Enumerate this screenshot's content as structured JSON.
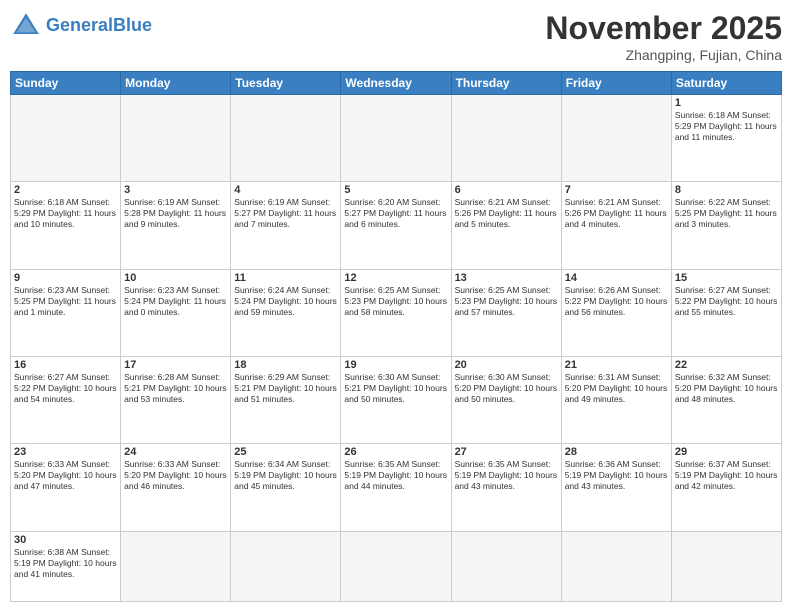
{
  "header": {
    "logo_general": "General",
    "logo_blue": "Blue",
    "month": "November 2025",
    "location": "Zhangping, Fujian, China"
  },
  "days_of_week": [
    "Sunday",
    "Monday",
    "Tuesday",
    "Wednesday",
    "Thursday",
    "Friday",
    "Saturday"
  ],
  "weeks": [
    [
      {
        "day": "",
        "info": "",
        "empty": true
      },
      {
        "day": "",
        "info": "",
        "empty": true
      },
      {
        "day": "",
        "info": "",
        "empty": true
      },
      {
        "day": "",
        "info": "",
        "empty": true
      },
      {
        "day": "",
        "info": "",
        "empty": true
      },
      {
        "day": "",
        "info": "",
        "empty": true
      },
      {
        "day": "1",
        "info": "Sunrise: 6:18 AM\nSunset: 5:29 PM\nDaylight: 11 hours\nand 11 minutes.",
        "empty": false
      }
    ],
    [
      {
        "day": "2",
        "info": "Sunrise: 6:18 AM\nSunset: 5:29 PM\nDaylight: 11 hours\nand 10 minutes.",
        "empty": false
      },
      {
        "day": "3",
        "info": "Sunrise: 6:19 AM\nSunset: 5:28 PM\nDaylight: 11 hours\nand 9 minutes.",
        "empty": false
      },
      {
        "day": "4",
        "info": "Sunrise: 6:19 AM\nSunset: 5:27 PM\nDaylight: 11 hours\nand 7 minutes.",
        "empty": false
      },
      {
        "day": "5",
        "info": "Sunrise: 6:20 AM\nSunset: 5:27 PM\nDaylight: 11 hours\nand 6 minutes.",
        "empty": false
      },
      {
        "day": "6",
        "info": "Sunrise: 6:21 AM\nSunset: 5:26 PM\nDaylight: 11 hours\nand 5 minutes.",
        "empty": false
      },
      {
        "day": "7",
        "info": "Sunrise: 6:21 AM\nSunset: 5:26 PM\nDaylight: 11 hours\nand 4 minutes.",
        "empty": false
      },
      {
        "day": "8",
        "info": "Sunrise: 6:22 AM\nSunset: 5:25 PM\nDaylight: 11 hours\nand 3 minutes.",
        "empty": false
      }
    ],
    [
      {
        "day": "9",
        "info": "Sunrise: 6:23 AM\nSunset: 5:25 PM\nDaylight: 11 hours\nand 1 minute.",
        "empty": false
      },
      {
        "day": "10",
        "info": "Sunrise: 6:23 AM\nSunset: 5:24 PM\nDaylight: 11 hours\nand 0 minutes.",
        "empty": false
      },
      {
        "day": "11",
        "info": "Sunrise: 6:24 AM\nSunset: 5:24 PM\nDaylight: 10 hours\nand 59 minutes.",
        "empty": false
      },
      {
        "day": "12",
        "info": "Sunrise: 6:25 AM\nSunset: 5:23 PM\nDaylight: 10 hours\nand 58 minutes.",
        "empty": false
      },
      {
        "day": "13",
        "info": "Sunrise: 6:25 AM\nSunset: 5:23 PM\nDaylight: 10 hours\nand 57 minutes.",
        "empty": false
      },
      {
        "day": "14",
        "info": "Sunrise: 6:26 AM\nSunset: 5:22 PM\nDaylight: 10 hours\nand 56 minutes.",
        "empty": false
      },
      {
        "day": "15",
        "info": "Sunrise: 6:27 AM\nSunset: 5:22 PM\nDaylight: 10 hours\nand 55 minutes.",
        "empty": false
      }
    ],
    [
      {
        "day": "16",
        "info": "Sunrise: 6:27 AM\nSunset: 5:22 PM\nDaylight: 10 hours\nand 54 minutes.",
        "empty": false
      },
      {
        "day": "17",
        "info": "Sunrise: 6:28 AM\nSunset: 5:21 PM\nDaylight: 10 hours\nand 53 minutes.",
        "empty": false
      },
      {
        "day": "18",
        "info": "Sunrise: 6:29 AM\nSunset: 5:21 PM\nDaylight: 10 hours\nand 51 minutes.",
        "empty": false
      },
      {
        "day": "19",
        "info": "Sunrise: 6:30 AM\nSunset: 5:21 PM\nDaylight: 10 hours\nand 50 minutes.",
        "empty": false
      },
      {
        "day": "20",
        "info": "Sunrise: 6:30 AM\nSunset: 5:20 PM\nDaylight: 10 hours\nand 50 minutes.",
        "empty": false
      },
      {
        "day": "21",
        "info": "Sunrise: 6:31 AM\nSunset: 5:20 PM\nDaylight: 10 hours\nand 49 minutes.",
        "empty": false
      },
      {
        "day": "22",
        "info": "Sunrise: 6:32 AM\nSunset: 5:20 PM\nDaylight: 10 hours\nand 48 minutes.",
        "empty": false
      }
    ],
    [
      {
        "day": "23",
        "info": "Sunrise: 6:33 AM\nSunset: 5:20 PM\nDaylight: 10 hours\nand 47 minutes.",
        "empty": false
      },
      {
        "day": "24",
        "info": "Sunrise: 6:33 AM\nSunset: 5:20 PM\nDaylight: 10 hours\nand 46 minutes.",
        "empty": false
      },
      {
        "day": "25",
        "info": "Sunrise: 6:34 AM\nSunset: 5:19 PM\nDaylight: 10 hours\nand 45 minutes.",
        "empty": false
      },
      {
        "day": "26",
        "info": "Sunrise: 6:35 AM\nSunset: 5:19 PM\nDaylight: 10 hours\nand 44 minutes.",
        "empty": false
      },
      {
        "day": "27",
        "info": "Sunrise: 6:35 AM\nSunset: 5:19 PM\nDaylight: 10 hours\nand 43 minutes.",
        "empty": false
      },
      {
        "day": "28",
        "info": "Sunrise: 6:36 AM\nSunset: 5:19 PM\nDaylight: 10 hours\nand 43 minutes.",
        "empty": false
      },
      {
        "day": "29",
        "info": "Sunrise: 6:37 AM\nSunset: 5:19 PM\nDaylight: 10 hours\nand 42 minutes.",
        "empty": false
      }
    ],
    [
      {
        "day": "30",
        "info": "Sunrise: 6:38 AM\nSunset: 5:19 PM\nDaylight: 10 hours\nand 41 minutes.",
        "empty": false
      },
      {
        "day": "",
        "info": "",
        "empty": true
      },
      {
        "day": "",
        "info": "",
        "empty": true
      },
      {
        "day": "",
        "info": "",
        "empty": true
      },
      {
        "day": "",
        "info": "",
        "empty": true
      },
      {
        "day": "",
        "info": "",
        "empty": true
      },
      {
        "day": "",
        "info": "",
        "empty": true
      }
    ]
  ]
}
